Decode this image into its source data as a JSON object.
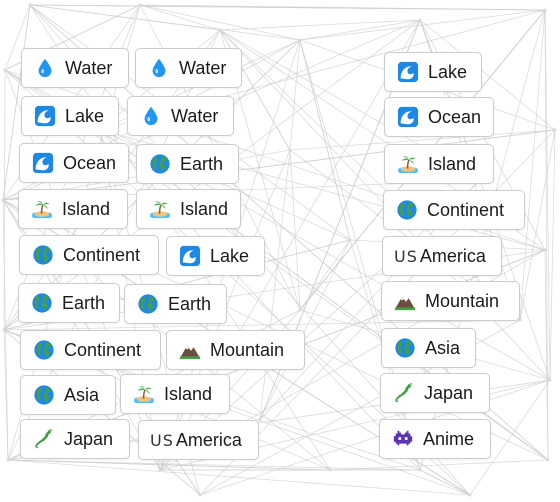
{
  "left_items": [
    {
      "label": "Water",
      "icon": "droplet-icon"
    },
    {
      "label": "Water",
      "icon": "droplet-icon"
    },
    {
      "label": "Lake",
      "icon": "wave-icon"
    },
    {
      "label": "Water",
      "icon": "droplet-icon"
    },
    {
      "label": "Ocean",
      "icon": "wave-icon"
    },
    {
      "label": "Earth",
      "icon": "globe-icon"
    },
    {
      "label": "Island",
      "icon": "island-icon"
    },
    {
      "label": "Island",
      "icon": "island-icon"
    },
    {
      "label": "Continent",
      "icon": "globe-icon"
    },
    {
      "label": "Lake",
      "icon": "wave-icon"
    },
    {
      "label": "Earth",
      "icon": "globe-icon"
    },
    {
      "label": "Earth",
      "icon": "globe-icon"
    },
    {
      "label": "Continent",
      "icon": "globe-icon"
    },
    {
      "label": "Mountain",
      "icon": "mountain-icon"
    },
    {
      "label": "Asia",
      "icon": "globe-icon"
    },
    {
      "label": "Island",
      "icon": "island-icon"
    },
    {
      "label": "Japan",
      "icon": "japan-map-icon"
    },
    {
      "label": "America",
      "icon": "us-flag-icon",
      "icon_text": "US"
    }
  ],
  "right_items": [
    {
      "label": "Lake",
      "icon": "wave-icon"
    },
    {
      "label": "Ocean",
      "icon": "wave-icon"
    },
    {
      "label": "Island",
      "icon": "island-icon"
    },
    {
      "label": "Continent",
      "icon": "globe-icon"
    },
    {
      "label": "America",
      "icon": "us-flag-icon",
      "icon_text": "US"
    },
    {
      "label": "Mountain",
      "icon": "mountain-icon"
    },
    {
      "label": "Asia",
      "icon": "globe-icon"
    },
    {
      "label": "Japan",
      "icon": "japan-map-icon"
    },
    {
      "label": "Anime",
      "icon": "alien-monster-icon"
    }
  ],
  "colors": {
    "chip_border": "#c8cdd2",
    "network_line": "#cfcfcf",
    "droplet": "#2196f3",
    "wave": "#1e88e5",
    "globe_ocean": "#1e88e5",
    "globe_land": "#43a047",
    "island_sand": "#f4c27a",
    "palm": "#4caf50",
    "mountain": "#6d4c41",
    "snow": "#ffffff",
    "japan": "#43a047",
    "alien": "#5e35b1"
  }
}
